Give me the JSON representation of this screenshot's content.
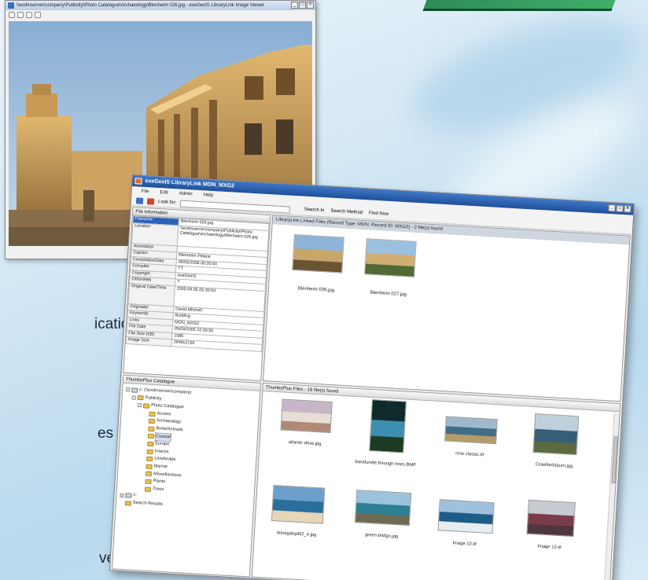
{
  "side_text": [
    "ication",
    "es",
    "ver"
  ],
  "photo_window": {
    "title": "\\\\exdmserver\\company\\Publicity\\Photo Catalogue\\Archaeology\\Blenheim 026.jpg - exeGesIS LibraryLink Image Viewer"
  },
  "app": {
    "title": "exeGesIS LibraryLink MON_MXG2",
    "menus": [
      "File",
      "Edit",
      "Admin",
      "Help"
    ],
    "toolbar": {
      "look_for_label": "Look for:",
      "look_for_value": "",
      "search_in": "Search In",
      "search_method": "Search Method",
      "find_now": "Find Now"
    },
    "file_info": {
      "header": "File Information",
      "rows": [
        {
          "key": "Filename",
          "value": "Blenheim 026.jpg",
          "selected": true
        },
        {
          "key": "Location",
          "value": "\\\\exdmserver\\company\\Publicity\\Photo Catalogue\\Archaeology\\Blenheim 026.jpg",
          "tall": true
        },
        {
          "key": "Annotation",
          "value": ""
        },
        {
          "key": "Caption",
          "value": "Blenheim Palace"
        },
        {
          "key": "CompilationDate",
          "value": "06/05/2008 00:00:00"
        },
        {
          "key": "Compiler",
          "value": "TT"
        },
        {
          "key": "Copyright",
          "value": "exeGesIS"
        },
        {
          "key": "OKforWeb",
          "value": "Y"
        },
        {
          "key": "Original Date/Time",
          "value": "2005:09:05 05:30:04",
          "tall": true
        },
        {
          "key": "Originator",
          "value": "David Mitchell"
        },
        {
          "key": "Keywords",
          "value": "Building"
        },
        {
          "key": "Links",
          "value": "MON_MXG2"
        },
        {
          "key": "File Date",
          "value": "05/09/2005 22:00:50"
        },
        {
          "key": "File Size (KB)",
          "value": "1586"
        },
        {
          "key": "Image Size",
          "value": "2848x2136"
        }
      ]
    },
    "linked": {
      "header": "LibraryLink Linked Files (Record Type: MON, Record ID: MXG2) - 2 file(s) found",
      "items": [
        {
          "label": "Blenheim 026.jpg",
          "colors": [
            "#8db3d8",
            "#c9a56a",
            "#6b5432"
          ]
        },
        {
          "label": "Blenheim 027.jpg",
          "colors": [
            "#9cc0e0",
            "#cfae74",
            "#4f6a34"
          ]
        }
      ]
    },
    "tree": {
      "header": "ThumbsPlus Catalogue",
      "nodes": [
        {
          "label": "c: (\\\\exdmserver\\company)",
          "level": 0,
          "pm": "-",
          "drive": true
        },
        {
          "label": "Publicity",
          "level": 1,
          "pm": "-"
        },
        {
          "label": "Photo Catalogue",
          "level": 2,
          "pm": "-"
        },
        {
          "label": "Access",
          "level": 3
        },
        {
          "label": "Archaeology",
          "level": 3
        },
        {
          "label": "Birds/Animals",
          "level": 3
        },
        {
          "label": "Coastal",
          "level": 3,
          "selected": true
        },
        {
          "label": "Europe",
          "level": 3
        },
        {
          "label": "Insects",
          "level": 3
        },
        {
          "label": "Landscape",
          "level": 3
        },
        {
          "label": "Marine",
          "level": 3
        },
        {
          "label": "Miscellaneous",
          "level": 3
        },
        {
          "label": "Plants",
          "level": 3
        },
        {
          "label": "Trees",
          "level": 3
        },
        {
          "label": "c:",
          "level": 0,
          "pm": "+",
          "drive": true
        },
        {
          "label": "Search Results",
          "level": 0
        }
      ]
    },
    "thumbsplus": {
      "header": "ThumbsPlus Files - 18 file(s) found",
      "items": [
        {
          "label": "atlantic drive.jpg",
          "colors": [
            "#c7b6c8",
            "#e9ddd8",
            "#b08a75"
          ]
        },
        {
          "label": "barafundle through trees.BMP",
          "colors": [
            "#0f2a2a",
            "#3c8fb0",
            "#1d3b22"
          ]
        },
        {
          "label": "cme classic.tif",
          "colors": [
            "#9fb9cc",
            "#3f6e86",
            "#b59b6a"
          ]
        },
        {
          "label": "Crawfordsburn.jpg",
          "colors": [
            "#bfd0dc",
            "#355f78",
            "#5b6b3f"
          ]
        },
        {
          "label": "donegalspt02_4.jpg",
          "colors": [
            "#6d9fcc",
            "#2a6f9c",
            "#e7d6b7"
          ]
        },
        {
          "label": "green bridge.jpg",
          "colors": [
            "#9cc3dd",
            "#2c7f95",
            "#6d6a52"
          ]
        },
        {
          "label": "Image 10.tif",
          "colors": [
            "#9fc1de",
            "#1d5c86",
            "#e6eef2"
          ]
        },
        {
          "label": "Image 13.tif",
          "colors": [
            "#c7cbd2",
            "#7a3c4a",
            "#4f3740"
          ]
        }
      ]
    }
  }
}
